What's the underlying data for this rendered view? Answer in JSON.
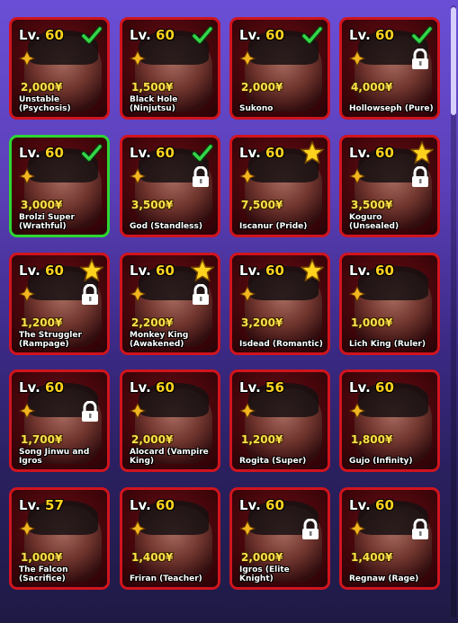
{
  "level_prefix": "Lv.",
  "colors": {
    "border": "#d0141e",
    "selected_border": "#2ed633",
    "price": "#ffe14a",
    "level": "#ffd21e"
  },
  "units": [
    {
      "level": "60",
      "price": "2,000¥",
      "name": "Unstable (Psychosis)",
      "badge": "check-icon",
      "locked": false,
      "selected": false
    },
    {
      "level": "60",
      "price": "1,500¥",
      "name": "Black Hole (Ninjutsu)",
      "badge": "check-icon",
      "locked": false,
      "selected": false
    },
    {
      "level": "60",
      "price": "2,000¥",
      "name": "Sukono",
      "badge": "check-icon",
      "locked": false,
      "selected": false
    },
    {
      "level": "60",
      "price": "4,000¥",
      "name": "Hollowseph (Pure)",
      "badge": "check-icon",
      "locked": true,
      "selected": false
    },
    {
      "level": "60",
      "price": "3,000¥",
      "name": "Brolzi Super (Wrathful)",
      "badge": "check-icon",
      "locked": false,
      "selected": true
    },
    {
      "level": "60",
      "price": "3,500¥",
      "name": "God (Standless)",
      "badge": "check-icon",
      "locked": true,
      "selected": false
    },
    {
      "level": "60",
      "price": "7,500¥",
      "name": "Iscanur (Pride)",
      "badge": "star-icon",
      "locked": false,
      "selected": false
    },
    {
      "level": "60",
      "price": "3,500¥",
      "name": "Koguro (Unsealed)",
      "badge": "star-icon",
      "locked": true,
      "selected": false
    },
    {
      "level": "60",
      "price": "1,200¥",
      "name": "The Struggler (Rampage)",
      "badge": "star-icon",
      "locked": true,
      "selected": false
    },
    {
      "level": "60",
      "price": "2,200¥",
      "name": "Monkey King (Awakened)",
      "badge": "star-icon",
      "locked": true,
      "selected": false
    },
    {
      "level": "60",
      "price": "3,200¥",
      "name": "Isdead (Romantic)",
      "badge": "star-icon",
      "locked": false,
      "selected": false
    },
    {
      "level": "60",
      "price": "1,000¥",
      "name": "Lich King (Ruler)",
      "badge": "",
      "locked": false,
      "selected": false
    },
    {
      "level": "60",
      "price": "1,700¥",
      "name": "Song Jinwu and Igros",
      "badge": "",
      "locked": true,
      "selected": false
    },
    {
      "level": "60",
      "price": "2,000¥",
      "name": "Alocard (Vampire King)",
      "badge": "",
      "locked": false,
      "selected": false
    },
    {
      "level": "56",
      "price": "1,200¥",
      "name": "Rogita (Super)",
      "badge": "",
      "locked": false,
      "selected": false
    },
    {
      "level": "60",
      "price": "1,800¥",
      "name": "Gujo (Infinity)",
      "badge": "",
      "locked": false,
      "selected": false
    },
    {
      "level": "57",
      "price": "1,000¥",
      "name": "The Falcon (Sacrifice)",
      "badge": "",
      "locked": false,
      "selected": false
    },
    {
      "level": "60",
      "price": "1,400¥",
      "name": "Friran (Teacher)",
      "badge": "",
      "locked": false,
      "selected": false
    },
    {
      "level": "60",
      "price": "2,000¥",
      "name": "Igros (Elite Knight)",
      "badge": "",
      "locked": true,
      "selected": false
    },
    {
      "level": "60",
      "price": "1,400¥",
      "name": "Regnaw (Rage)",
      "badge": "",
      "locked": true,
      "selected": false
    }
  ]
}
